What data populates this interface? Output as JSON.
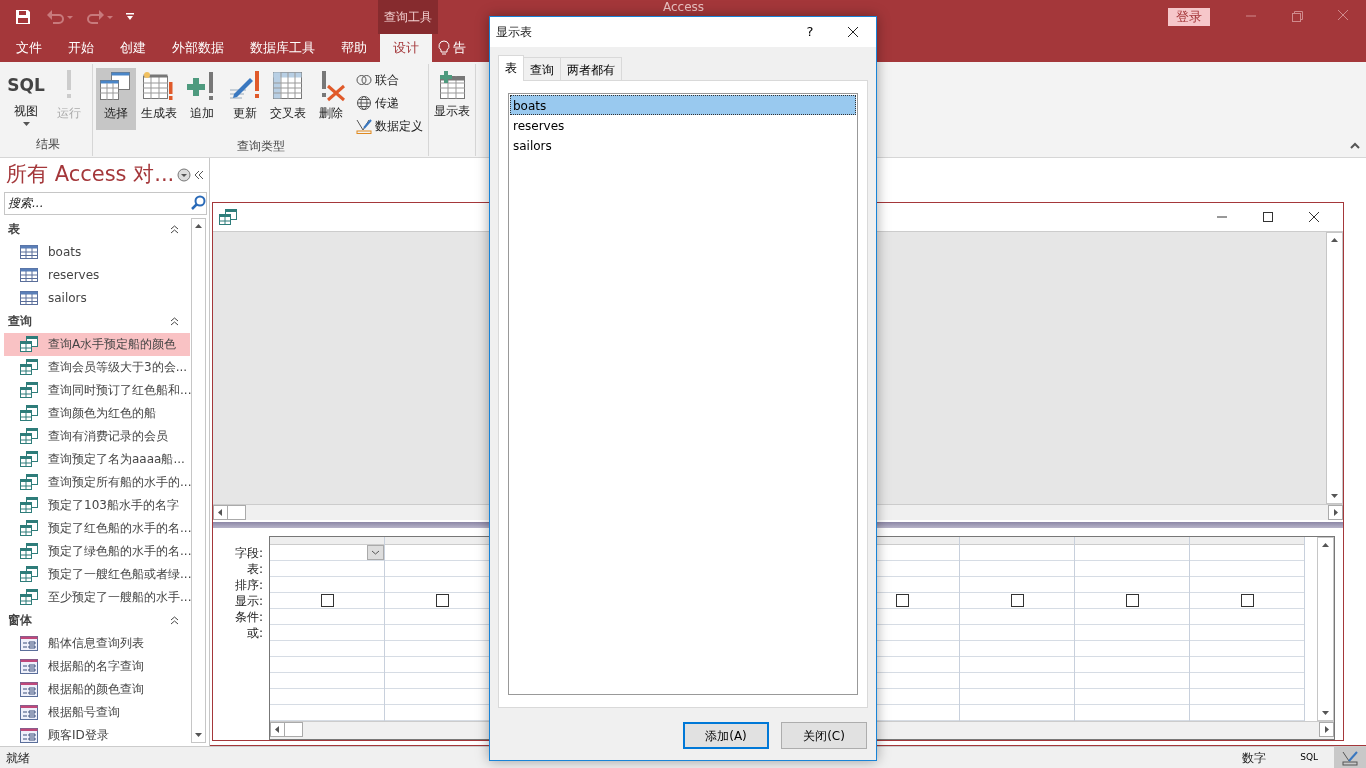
{
  "title_bar": {
    "title": "Access",
    "context_tab": "查询工具",
    "sign_in": "登录"
  },
  "ribbon_tabs": [
    {
      "label": "文件",
      "selected": false
    },
    {
      "label": "开始",
      "selected": false
    },
    {
      "label": "创建",
      "selected": false
    },
    {
      "label": "外部数据",
      "selected": false
    },
    {
      "label": "数据库工具",
      "selected": false
    },
    {
      "label": "帮助",
      "selected": false
    },
    {
      "label": "设计",
      "selected": true
    }
  ],
  "tell_me": {
    "label": "告"
  },
  "ribbon_groups": [
    {
      "label": "结果",
      "buttons": [
        {
          "kind": "sql",
          "icon_text": "SQL",
          "label": "视图",
          "disabled": false,
          "selected": false
        },
        {
          "kind": "run",
          "label": "运行",
          "disabled": true,
          "selected": false
        }
      ]
    },
    {
      "label": "查询类型",
      "buttons": [
        {
          "kind": "select",
          "label": "选择",
          "disabled": false,
          "selected": true
        },
        {
          "kind": "make-table",
          "label": "生成表",
          "disabled": false,
          "selected": false
        },
        {
          "kind": "append",
          "label": "追加",
          "disabled": false,
          "selected": false
        },
        {
          "kind": "update",
          "label": "更新",
          "disabled": false,
          "selected": false
        },
        {
          "kind": "crosstab",
          "label": "交叉表",
          "disabled": false,
          "selected": false
        },
        {
          "kind": "delete",
          "label": "删除",
          "disabled": false,
          "selected": false
        },
        {
          "kind": "union",
          "label": "联合",
          "disabled": false,
          "selected": false
        },
        {
          "kind": "pass-through",
          "label": "传递",
          "disabled": false,
          "selected": false
        },
        {
          "kind": "data-definition",
          "label": "数据定义",
          "disabled": false,
          "selected": false
        }
      ]
    },
    {
      "buttons": [
        {
          "kind": "show-table",
          "label": "显示表",
          "disabled": false,
          "selected": false
        }
      ]
    }
  ],
  "nav": {
    "title": "所有 Access 对...",
    "search_placeholder": "搜索...",
    "groups": [
      {
        "label": "表",
        "kind": "table",
        "expanded": true,
        "items": [
          {
            "label": "boats",
            "selected": false
          },
          {
            "label": "reserves",
            "selected": false
          },
          {
            "label": "sailors",
            "selected": false
          }
        ]
      },
      {
        "label": "查询",
        "kind": "query",
        "expanded": true,
        "items": [
          {
            "label": "查询A水手预定船的颜色",
            "selected": true
          },
          {
            "label": "查询会员等级大于3的会...",
            "selected": false
          },
          {
            "label": "查询同时预订了红色船和...",
            "selected": false
          },
          {
            "label": "查询颜色为红色的船",
            "selected": false
          },
          {
            "label": "查询有消费记录的会员",
            "selected": false
          },
          {
            "label": "查询预定了名为aaaa船...",
            "selected": false
          },
          {
            "label": "查询预定所有船的水手的...",
            "selected": false
          },
          {
            "label": "预定了103船水手的名字",
            "selected": false
          },
          {
            "label": "预定了红色船的水手的名...",
            "selected": false
          },
          {
            "label": "预定了绿色船的水手的名...",
            "selected": false
          },
          {
            "label": "预定了一艘红色船或者绿...",
            "selected": false
          },
          {
            "label": "至少预定了一艘船的水手...",
            "selected": false
          }
        ]
      },
      {
        "label": "窗体",
        "kind": "form",
        "expanded": true,
        "items": [
          {
            "label": "船体信息查询列表",
            "selected": false
          },
          {
            "label": "根据船的名字查询",
            "selected": false
          },
          {
            "label": "根据船的颜色查询",
            "selected": false
          },
          {
            "label": "根据船号查询",
            "selected": false
          },
          {
            "label": "顾客ID登录",
            "selected": false
          }
        ]
      }
    ]
  },
  "grid": {
    "row_labels": [
      "字段:",
      "表:",
      "排序:",
      "显示:",
      "条件:",
      "或:"
    ],
    "columns": [
      {
        "selected": true,
        "show": false
      },
      {
        "selected": false,
        "show": false
      },
      {
        "selected": false,
        "show": false
      },
      {
        "selected": false,
        "show": false
      },
      {
        "selected": false,
        "show": false
      },
      {
        "selected": false,
        "show": false
      }
    ]
  },
  "dialog": {
    "title": "显示表",
    "help": "?",
    "tabs": [
      {
        "label": "表",
        "selected": true
      },
      {
        "label": "查询",
        "selected": false
      },
      {
        "label": "两者都有",
        "selected": false
      }
    ],
    "items": [
      {
        "label": "boats",
        "selected": true
      },
      {
        "label": "reserves",
        "selected": false
      },
      {
        "label": "sailors",
        "selected": false
      }
    ],
    "buttons": [
      {
        "label": "添加(A)",
        "default": true
      },
      {
        "label": "关闭(C)",
        "default": false
      }
    ]
  },
  "status_bar": {
    "text": "就绪",
    "mode": "数字",
    "sql_view": "SQL"
  }
}
